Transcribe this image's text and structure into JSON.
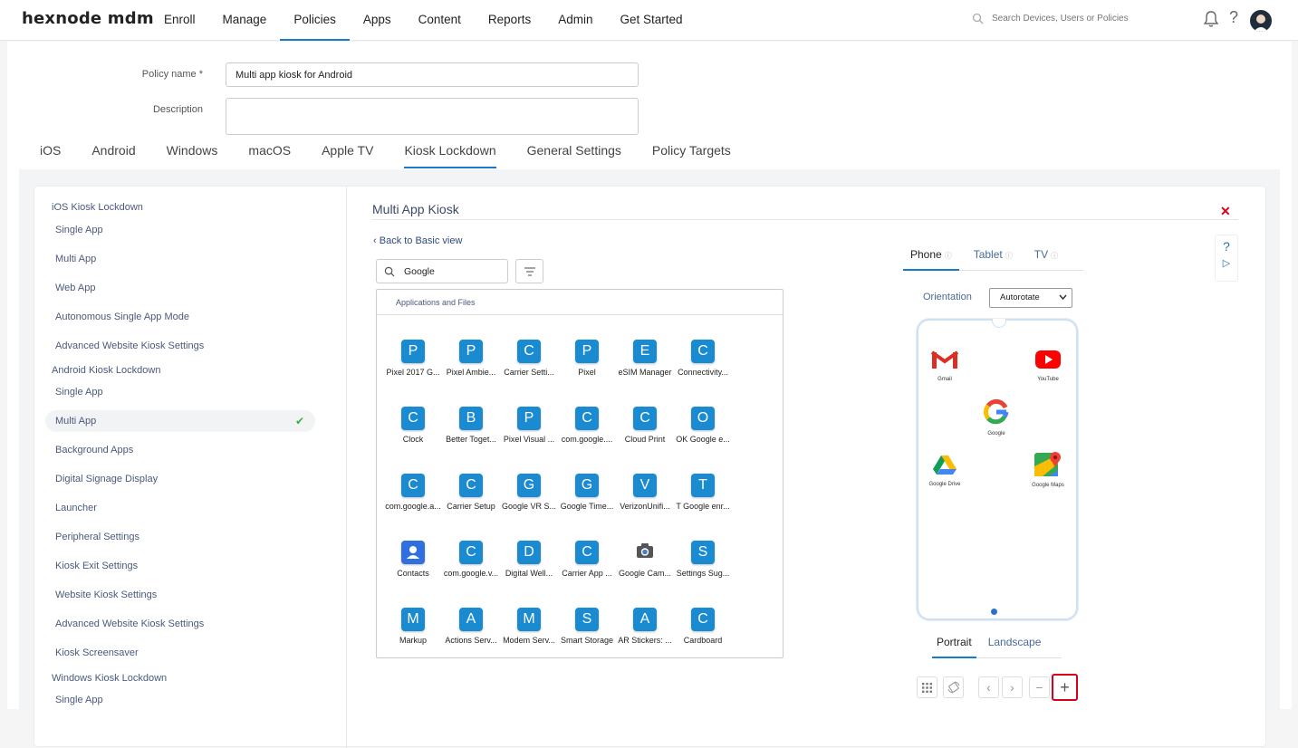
{
  "brand": "hexnode mdm",
  "nav": [
    "Enroll",
    "Manage",
    "Policies",
    "Apps",
    "Content",
    "Reports",
    "Admin",
    "Get Started"
  ],
  "search": {
    "placeholder": "Search Devices, Users or Policies"
  },
  "form": {
    "policy_name_label": "Policy name *",
    "policy_name_value": "Multi app kiosk for Android",
    "description_label": "Description"
  },
  "platform_tabs": [
    "iOS",
    "Android",
    "Windows",
    "macOS",
    "Apple TV",
    "Kiosk Lockdown",
    "General Settings",
    "Policy Targets"
  ],
  "sidebar": {
    "ios_heading": "iOS Kiosk Lockdown",
    "ios_items": [
      "Single App",
      "Multi App",
      "Web App",
      "Autonomous Single App Mode",
      "Advanced Website Kiosk Settings"
    ],
    "android_heading": "Android Kiosk Lockdown",
    "android_items": [
      "Single App",
      "Multi App",
      "Background Apps",
      "Digital Signage Display",
      "Launcher",
      "Peripheral Settings",
      "Kiosk Exit Settings",
      "Website Kiosk Settings",
      "Advanced Website Kiosk Settings",
      "Kiosk Screensaver"
    ],
    "windows_heading": "Windows Kiosk Lockdown",
    "windows_items": [
      "Single App"
    ]
  },
  "main": {
    "title": "Multi App Kiosk",
    "back_link": "Back to Basic view",
    "app_search_value": "Google",
    "apps_header": "Applications and Files",
    "apps": [
      [
        {
          "l": "P",
          "n": "Pixel 2017 G..."
        },
        {
          "l": "P",
          "n": "Pixel Ambie..."
        },
        {
          "l": "C",
          "n": "Carrier Setti..."
        },
        {
          "l": "P",
          "n": "Pixel"
        },
        {
          "l": "E",
          "n": "eSIM Manager"
        },
        {
          "l": "C",
          "n": "Connectivity..."
        }
      ],
      [
        {
          "l": "C",
          "n": "Clock"
        },
        {
          "l": "B",
          "n": "Better Toget..."
        },
        {
          "l": "P",
          "n": "Pixel Visual ..."
        },
        {
          "l": "C",
          "n": "com.google...."
        },
        {
          "l": "C",
          "n": "Cloud Print"
        },
        {
          "l": "O",
          "n": "OK Google e..."
        }
      ],
      [
        {
          "l": "C",
          "n": "com.google.a..."
        },
        {
          "l": "C",
          "n": "Carrier Setup"
        },
        {
          "l": "G",
          "n": "Google VR S..."
        },
        {
          "l": "G",
          "n": "Google Time..."
        },
        {
          "l": "V",
          "n": "VerizonUnifi..."
        },
        {
          "l": "T",
          "n": "T Google enr..."
        }
      ],
      [
        {
          "l": "",
          "n": "Contacts",
          "k": "contacts"
        },
        {
          "l": "C",
          "n": "com.google.v..."
        },
        {
          "l": "D",
          "n": "Digital Well..."
        },
        {
          "l": "C",
          "n": "Carrier App ..."
        },
        {
          "l": "",
          "n": "Google Cam...",
          "k": "camera"
        },
        {
          "l": "S",
          "n": "Settings Sug..."
        }
      ],
      [
        {
          "l": "M",
          "n": "Markup"
        },
        {
          "l": "A",
          "n": "Actions Serv..."
        },
        {
          "l": "M",
          "n": "Modem Serv..."
        },
        {
          "l": "S",
          "n": "Smart Storage"
        },
        {
          "l": "A",
          "n": "AR Stickers: ..."
        },
        {
          "l": "C",
          "n": "Cardboard"
        }
      ]
    ]
  },
  "device": {
    "tabs": [
      "Phone",
      "Tablet",
      "TV"
    ],
    "orientation_label": "Orientation",
    "orientation_value": "Autorotate",
    "phone_apps": [
      "Gmail",
      "YouTube",
      "Google",
      "Google Drive",
      "Google Maps"
    ],
    "orient_tabs": [
      "Portrait",
      "Landscape"
    ]
  },
  "colors": {
    "accent": "#1b7ac7",
    "app_icon": "#1a8ad1",
    "close": "#d9001b",
    "check": "#3fae49"
  }
}
